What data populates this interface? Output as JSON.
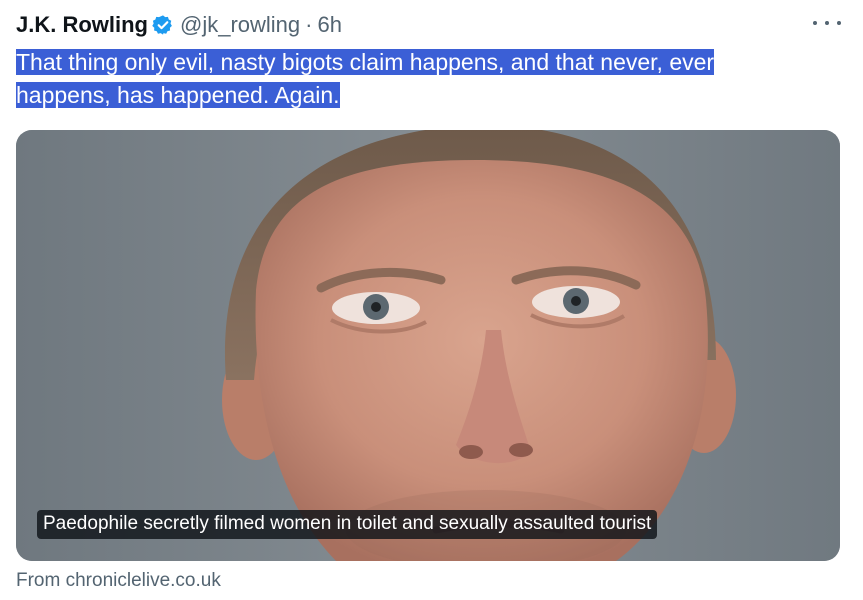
{
  "author": {
    "name": "J.K. Rowling",
    "handle": "@jk_rowling",
    "separator": "·",
    "time": "6h",
    "verified_icon": "verified-badge-icon"
  },
  "tweet": {
    "text": "That thing only evil, nasty bigots claim happens, and that never, ever happens, has happened. Again."
  },
  "card": {
    "caption": "Paedophile secretly filmed women in toilet and sexually assaulted tourist",
    "source": "From chroniclelive.co.uk"
  },
  "colors": {
    "selection": "#3b5fd6",
    "verified": "#1d9bf0",
    "secondary_text": "#536471"
  }
}
